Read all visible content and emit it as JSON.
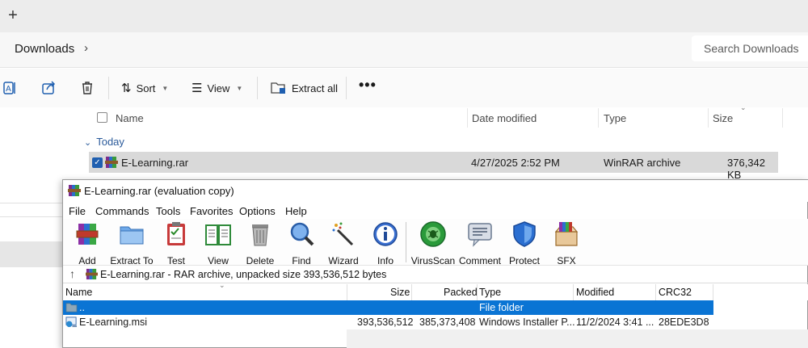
{
  "explorer": {
    "new_tab_glyph": "+",
    "breadcrumb": {
      "folder": "Downloads",
      "chevron": "›"
    },
    "search": {
      "placeholder": "Search Downloads"
    },
    "commands": {
      "sort": "Sort",
      "view": "View",
      "extract_all": "Extract all",
      "more": "•••"
    },
    "columns": {
      "name": "Name",
      "date_modified": "Date modified",
      "type": "Type",
      "size": "Size"
    },
    "group_label": "Today",
    "group_chevron": "⌄",
    "files": [
      {
        "name": "E-Learning.rar",
        "date_modified": "4/27/2025 2:52 PM",
        "type": "WinRAR archive",
        "size": "376,342 KB",
        "selected": true
      }
    ]
  },
  "winrar": {
    "title": "E-Learning.rar (evaluation copy)",
    "menu": [
      "File",
      "Commands",
      "Tools",
      "Favorites",
      "Options",
      "Help"
    ],
    "toolbar": [
      {
        "label": "Add",
        "icon": "add-archive-icon"
      },
      {
        "label": "Extract To",
        "icon": "extract-to-folder-icon"
      },
      {
        "label": "Test",
        "icon": "test-clipboard-icon"
      },
      {
        "label": "View",
        "icon": "view-book-icon"
      },
      {
        "label": "Delete",
        "icon": "trash-bin-icon"
      },
      {
        "label": "Find",
        "icon": "magnifier-icon"
      },
      {
        "label": "Wizard",
        "icon": "magic-wand-icon"
      },
      {
        "label": "Info",
        "icon": "info-icon"
      },
      {
        "label": "VirusScan",
        "icon": "virus-scan-icon"
      },
      {
        "label": "Comment",
        "icon": "comment-icon"
      },
      {
        "label": "Protect",
        "icon": "shield-icon"
      },
      {
        "label": "SFX",
        "icon": "sfx-box-icon"
      }
    ],
    "path_up": "↑",
    "path_text": "E-Learning.rar - RAR archive, unpacked size 393,536,512 bytes",
    "columns": {
      "name": "Name",
      "size": "Size",
      "packed": "Packed",
      "type": "Type",
      "modified": "Modified",
      "crc32": "CRC32"
    },
    "rows": [
      {
        "name": "..",
        "size": "",
        "packed": "",
        "type": "File folder",
        "modified": "",
        "crc32": "",
        "selected": true
      },
      {
        "name": "E-Learning.msi",
        "size": "393,536,512",
        "packed": "385,373,408",
        "type": "Windows Installer P...",
        "modified": "11/2/2024 3:41 ...",
        "crc32": "28EDE3D8",
        "selected": false
      }
    ],
    "colors": {
      "selection": "#0a74d4",
      "folder_text": "#ffffff"
    }
  }
}
